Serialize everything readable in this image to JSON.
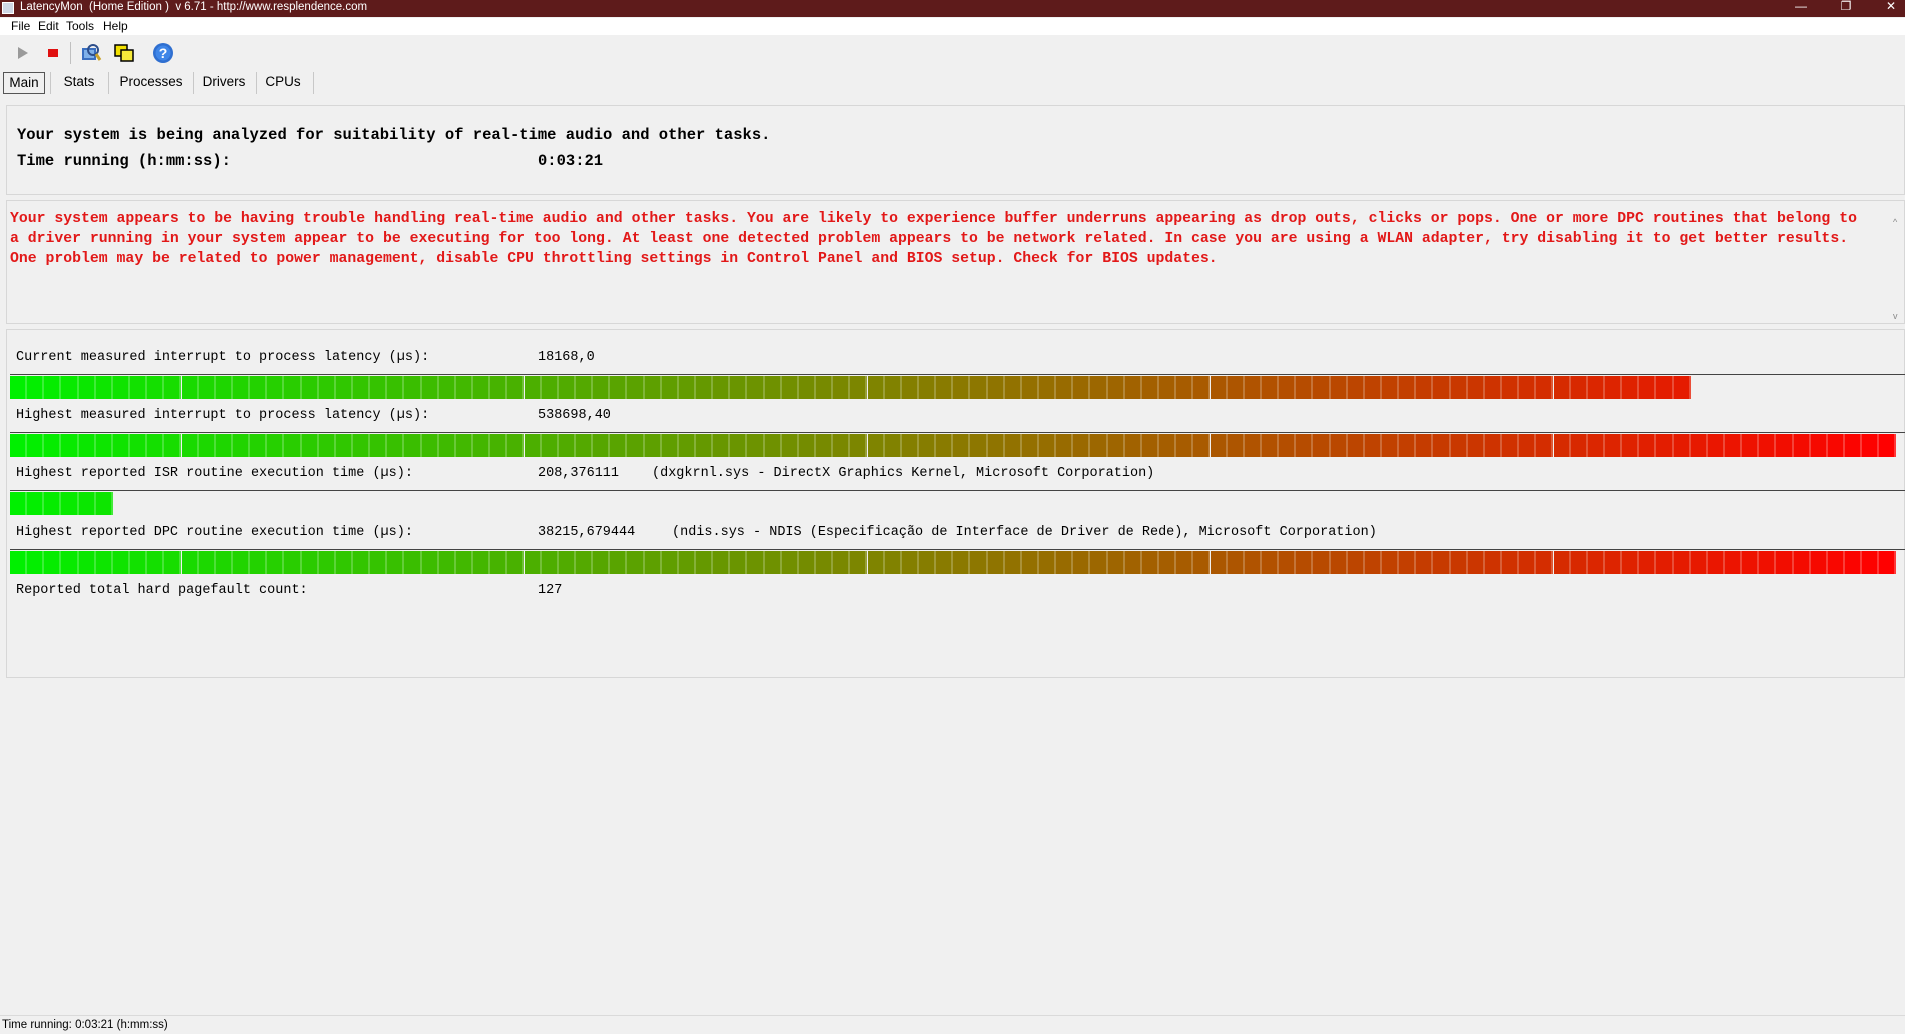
{
  "window": {
    "title": "LatencyMon  (Home Edition )  v 6.71 - http://www.resplendence.com",
    "minimize_glyph": "—",
    "restore_glyph": "❐",
    "close_glyph": "✕"
  },
  "menu": [
    "File",
    "Edit",
    "Tools",
    "Help"
  ],
  "toolbar": {
    "icons": [
      "play-icon",
      "stop-icon",
      "search-driver-icon",
      "windows-icon",
      "help-icon"
    ],
    "help_glyph": "?"
  },
  "tabs": [
    "Main",
    "Stats",
    "Processes",
    "Drivers",
    "CPUs"
  ],
  "header": {
    "heading": "Your system is being analyzed for suitability of real-time audio and other tasks.",
    "time_label": "Time running (h:mm:ss):",
    "time_value": "0:03:21"
  },
  "warning": {
    "text": "Your system appears to be having trouble handling real-time audio and other tasks. You are likely to experience buffer underruns appearing as drop outs, clicks or pops. One or more DPC routines that belong to a driver running in your system appear to be executing for too long. At least one detected problem appears to be network related. In case you are using a WLAN adapter, try disabling it to get better results. One problem may be related to power management, disable CPU throttling settings in Control Panel and BIOS setup. Check for BIOS updates.",
    "color": "#e21818"
  },
  "metrics": [
    {
      "label": "Current measured interrupt to process latency (µs):",
      "value": "18168,0",
      "detail": "",
      "fill": 0.887
    },
    {
      "label": "Highest measured interrupt to process latency (µs):",
      "value": "538698,40",
      "detail": "",
      "fill": 1.0
    },
    {
      "label": "Highest reported ISR routine execution time (µs):",
      "value": "208,376111",
      "detail": "(dxgkrnl.sys - DirectX Graphics Kernel, Microsoft Corporation)",
      "fill": 0.057
    },
    {
      "label": "Highest reported DPC routine execution time (µs):",
      "value": "38215,679444",
      "detail": "(ndis.sys - NDIS (Especificação de Interface de Driver de Rede), Microsoft Corporation)",
      "fill": 1.0
    }
  ],
  "pagefault": {
    "label": "Reported total hard pagefault count:",
    "value": "127"
  },
  "status": {
    "text": "Time running: 0:03:21  (h:mm:ss)"
  },
  "colors": {
    "bar_start": "#00f000",
    "bar_mid": "#8a7a00",
    "bar_end": "#ff0000",
    "titlebar": "#5e1b1b"
  }
}
